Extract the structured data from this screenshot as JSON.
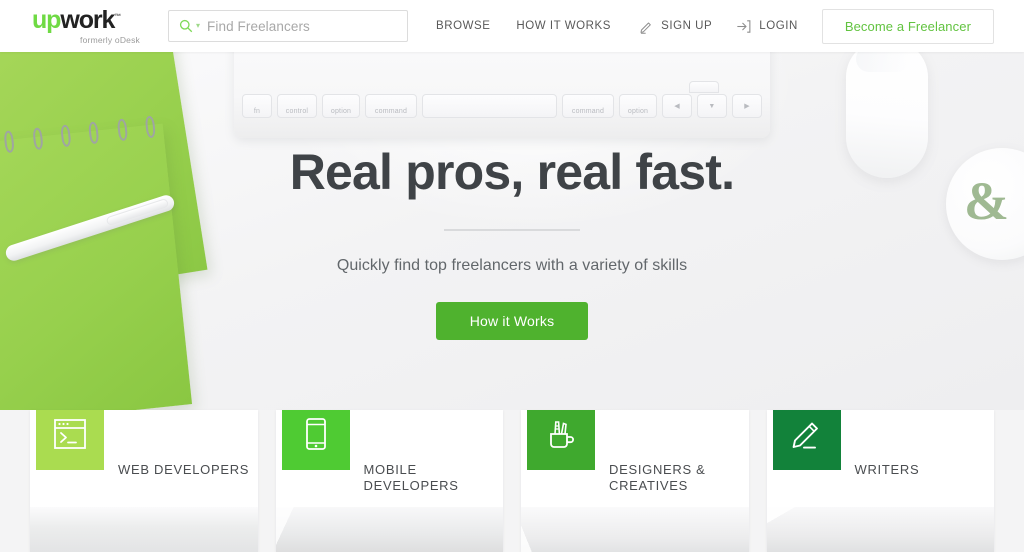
{
  "header": {
    "logo": {
      "name": "upwork",
      "part_green": "up",
      "part_dark": "work",
      "trademark": "™",
      "tagline": "formerly oDesk"
    },
    "search": {
      "placeholder": "Find Freelancers",
      "icon": "search-icon",
      "caret": "⌄"
    },
    "nav_links": [
      {
        "label": "BROWSE"
      },
      {
        "label": "HOW IT WORKS"
      }
    ],
    "account_links": [
      {
        "label": "SIGN UP",
        "icon": "pencil-icon"
      },
      {
        "label": "LOGIN",
        "icon": "login-arrow-icon"
      }
    ],
    "cta_button": "Become a Freelancer"
  },
  "hero": {
    "title": "Real pros, real fast.",
    "subtitle": "Quickly find top freelancers with a variety of skills",
    "cta_button": "How it Works",
    "background_objects": [
      "green-spiral-notebook",
      "white-pen",
      "apple-keyboard",
      "white-mouse",
      "white-mug"
    ],
    "keyboard_keys": [
      "fn",
      "control",
      "option",
      "command",
      "",
      "command",
      "option",
      "◀",
      "▼",
      "▶"
    ]
  },
  "categories": [
    {
      "label": "WEB DEVELOPERS",
      "icon": "terminal-window-icon",
      "color": "#aadc50"
    },
    {
      "label": "MOBILE DEVELOPERS",
      "icon": "smartphone-icon",
      "color": "#4fcb33"
    },
    {
      "label": "DESIGNERS & CREATIVES",
      "icon": "pencil-cup-icon",
      "color": "#3fa92e"
    },
    {
      "label": "WRITERS",
      "icon": "pencil-icon",
      "color": "#12823a"
    }
  ],
  "colors": {
    "brand_green": "#6fda44",
    "cta_green": "#4fb22e",
    "link_green": "#62c340",
    "text_dark": "#3f4347",
    "text_muted": "#62676b",
    "page_bg": "#f4f4f5"
  }
}
